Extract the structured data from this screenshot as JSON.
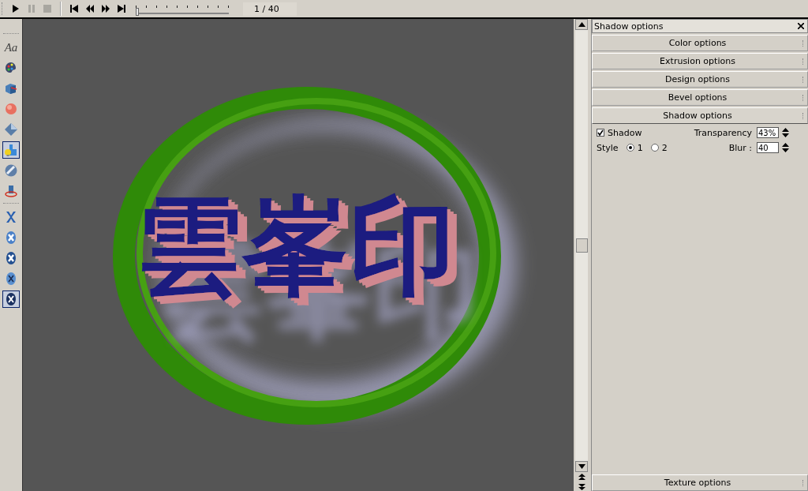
{
  "transport": {
    "buttons": [
      {
        "kind": "play",
        "disabled": false
      },
      {
        "kind": "pause",
        "disabled": true
      },
      {
        "kind": "stop",
        "disabled": true
      },
      {
        "kind": "first",
        "disabled": false
      },
      {
        "kind": "rewind",
        "disabled": false
      },
      {
        "kind": "forward",
        "disabled": false
      },
      {
        "kind": "last",
        "disabled": false
      }
    ],
    "timeline": {
      "level": 0
    },
    "frame": "1 / 40"
  },
  "tools": [
    {
      "kind": "text",
      "label": "Aa",
      "selected": false
    },
    {
      "kind": "palette",
      "selected": false
    },
    {
      "kind": "extrude",
      "selected": false
    },
    {
      "kind": "sphere",
      "selected": false
    },
    {
      "kind": "diamond",
      "selected": false
    },
    {
      "kind": "light",
      "selected": true
    },
    {
      "kind": "texture",
      "selected": false
    },
    {
      "kind": "rotate",
      "selected": false
    },
    {
      "kind": "separator"
    },
    {
      "kind": "x-plain",
      "selected": false
    },
    {
      "kind": "x-disc",
      "selected": false
    },
    {
      "kind": "x-bold",
      "selected": false
    },
    {
      "kind": "x-thin",
      "selected": false
    },
    {
      "kind": "x-dark",
      "selected": true
    }
  ],
  "canvas": {
    "text": "雲峯印"
  },
  "panel": {
    "title": "Shadow options",
    "sections": [
      {
        "label": "Color options",
        "expanded": false
      },
      {
        "label": "Extrusion options",
        "expanded": false
      },
      {
        "label": "Design options",
        "expanded": false
      },
      {
        "label": "Bevel options",
        "expanded": false
      },
      {
        "label": "Shadow options",
        "expanded": true
      },
      {
        "label": "Texture options",
        "expanded": false
      }
    ],
    "shadow": {
      "checkbox": {
        "label": "Shadow",
        "checked": true
      },
      "transparency_label": "Transparency",
      "transparency": "43%",
      "style_label": "Style",
      "styles": [
        {
          "label": "1",
          "selected": true
        },
        {
          "label": "2",
          "selected": false
        }
      ],
      "blur_label": "Blur :",
      "blur": "40"
    }
  }
}
